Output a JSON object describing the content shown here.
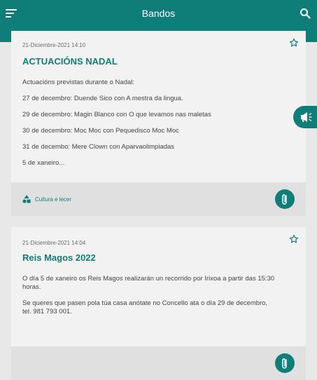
{
  "header": {
    "title": "Bandos",
    "menu_icon": "menu-icon",
    "search_icon": "search-icon"
  },
  "colors": {
    "primary": "#0f7d78",
    "card": "#f2f2f2",
    "footer": "#e0e0e0"
  },
  "bandos": [
    {
      "date": "21-Diciembre-2021 14:10",
      "title": "ACTUACIÓNS NADAL",
      "lines": [
        "Actuacións previstas durante o Nadal:",
        "27 de decembro: Duende Sico con A mestra da lingua.",
        "29 de decembro: Magin Blanco con O que levamos nas maletas",
        "30 de decembro: Moc Moc con Pequedisco Moc Moc",
        "31 de decembo: Mere Clown con Aparvaolimpiadas",
        "5 de xaneiro..."
      ],
      "category": "Cultura e lecer",
      "category_icon": "shapes-icon",
      "attachment_icon": "paperclip-icon",
      "favorite_icon": "star-outline-icon"
    },
    {
      "date": "21-Diciembre-2021 14:04",
      "title": "Reis Magos 2022",
      "paragraphs": [
        "O día 5 de xaneiro os Reis Magos realizarán un recorrido por Irixoa a partir das 15:30 horas.",
        "Se queres que pasen pola túa casa anótate no Concello ata o día 29 de decembro, tel. 981 793 001."
      ],
      "attachment_icon": "paperclip-icon",
      "favorite_icon": "star-outline-icon"
    }
  ],
  "fab": {
    "icon": "megaphone-icon"
  }
}
